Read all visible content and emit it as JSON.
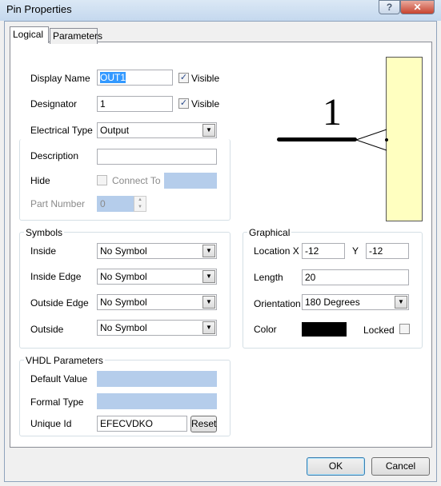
{
  "window": {
    "title": "Pin Properties",
    "help": "?",
    "close": "✕"
  },
  "tabs": [
    {
      "label": "Logical",
      "active": true
    },
    {
      "label": "Parameters",
      "active": false
    }
  ],
  "logical": {
    "display_name_label": "Display Name",
    "display_name": "OUT1",
    "visible1_label": "Visible",
    "visible1": true,
    "designator_label": "Designator",
    "designator": "1",
    "visible2_label": "Visible",
    "visible2": true,
    "electrical_type_label": "Electrical Type",
    "electrical_type": "Output",
    "description_label": "Description",
    "description": "",
    "hide_label": "Hide",
    "connect_to_label": "Connect To",
    "connect_to": "",
    "part_number_label": "Part Number",
    "part_number": "0"
  },
  "symbols": {
    "title": "Symbols",
    "rows": [
      {
        "label": "Inside",
        "value": "No Symbol"
      },
      {
        "label": "Inside Edge",
        "value": "No Symbol"
      },
      {
        "label": "Outside Edge",
        "value": "No Symbol"
      },
      {
        "label": "Outside",
        "value": "No Symbol"
      }
    ]
  },
  "graphical": {
    "title": "Graphical",
    "location_label": "Location X",
    "x": "-12",
    "y_label": "Y",
    "y": "-12",
    "length_label": "Length",
    "length": "20",
    "orientation_label": "Orientation",
    "orientation": "180 Degrees",
    "color_label": "Color",
    "color": "#000000",
    "locked_label": "Locked",
    "locked": false
  },
  "vhdl": {
    "title": "VHDL Parameters",
    "default_value_label": "Default Value",
    "default_value": "",
    "formal_type_label": "Formal Type",
    "formal_type": "",
    "unique_id_label": "Unique Id",
    "unique_id": "EFECVDKO",
    "reset": "Reset"
  },
  "preview": {
    "designator": "1",
    "body_color": "#ffffc0"
  },
  "footer": {
    "ok": "OK",
    "cancel": "Cancel"
  }
}
